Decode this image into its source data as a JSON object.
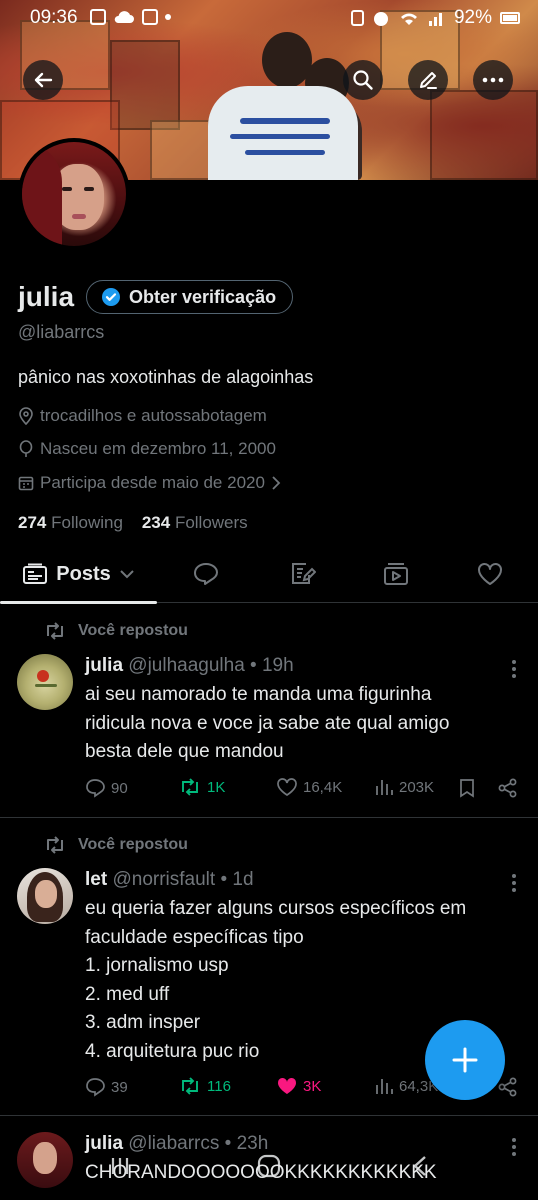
{
  "status_bar": {
    "time": "09:36",
    "battery": "92%"
  },
  "profile": {
    "name": "julia",
    "verify_label": "Obter verificação",
    "handle": "@liabarrcs",
    "bio": "pânico nas xoxotinhas de alagoinhas",
    "location": "trocadilhos e autossabotagem",
    "birthday": "Nasceu em dezembro 11, 2000",
    "joined": "Participa desde maio de 2020",
    "following_count": "274",
    "following_label": "Following",
    "followers_count": "234",
    "followers_label": "Followers"
  },
  "tabs": {
    "posts_label": "Posts"
  },
  "posts": [
    {
      "repost_label": "Você repostou",
      "name": "julia",
      "handle_time": "@julhaagulha • 19h",
      "lines": [
        "ai seu namorado te manda uma figurinha",
        "ridicula nova e voce ja sabe ate qual amigo",
        "besta dele que mandou"
      ],
      "replies": "90",
      "reposts": "1K",
      "likes": "16,4K",
      "views": "203K"
    },
    {
      "repost_label": "Você repostou",
      "name": "let",
      "handle_time": "@norrisfault • 1d",
      "lines": [
        "eu queria fazer alguns cursos específicos em",
        "faculdade específicas tipo",
        "1. jornalismo usp",
        "2. med uff",
        "3. adm insper",
        "4. arquitetura puc rio"
      ],
      "replies": "39",
      "reposts": "116",
      "likes": "3K",
      "views": "64,3K"
    },
    {
      "name": "julia",
      "handle_time": "@liabarrcs • 23h",
      "lines": [
        "CHORANDOOOOOOOKKKKKKKKKKKK"
      ]
    }
  ],
  "colors": {
    "accent": "#1d9bf0",
    "repost_green": "#00ba7c",
    "like_pink": "#f91880",
    "muted": "#71767b"
  }
}
